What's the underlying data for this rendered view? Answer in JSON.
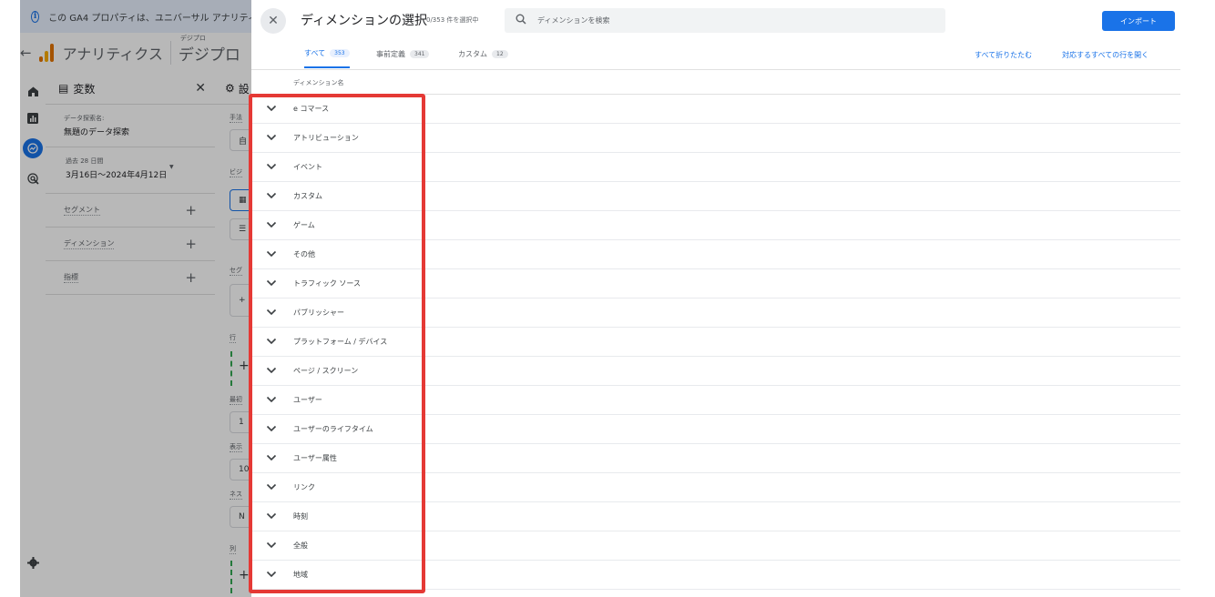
{
  "banner": {
    "text": "この GA4 プロパティは、ユニバーサル アナリティ"
  },
  "app": {
    "name": "アナリティクス",
    "property_small": "デジプロ",
    "property_big": "デジプロ"
  },
  "variables_panel": {
    "title": "変数",
    "exploration_label": "データ探索名:",
    "exploration_name": "無題のデータ探索",
    "date_label": "過去 28 日間",
    "date_range": "3月16日～2024年4月12日",
    "rows": [
      {
        "label": "セグメント"
      },
      {
        "label": "ディメンション"
      },
      {
        "label": "指標"
      }
    ]
  },
  "settings_panel": {
    "title": "設",
    "values": [
      "自",
      "1",
      "10",
      "N"
    ]
  },
  "dialog": {
    "title": "ディメンションの選択",
    "count": "0/353 件を選択中",
    "search_placeholder": "ディメンションを検索",
    "import_label": "インポート",
    "tabs": [
      {
        "label": "すべて",
        "count": "353"
      },
      {
        "label": "事前定義",
        "count": "341"
      },
      {
        "label": "カスタム",
        "count": "12"
      }
    ],
    "collapse_all": "すべて折りたたむ",
    "expand_all": "対応するすべての行を開く",
    "column_header": "ディメンション名",
    "dimensions": [
      "e コマース",
      "アトリビューション",
      "イベント",
      "カスタム",
      "ゲーム",
      "その他",
      "トラフィック ソース",
      "パブリッシャー",
      "プラットフォーム / デバイス",
      "ページ / スクリーン",
      "ユーザー",
      "ユーザーのライフタイム",
      "ユーザー属性",
      "リンク",
      "時刻",
      "全般",
      "地域"
    ]
  },
  "colors": {
    "accent": "#1a73e8",
    "highlight": "#e53935"
  }
}
